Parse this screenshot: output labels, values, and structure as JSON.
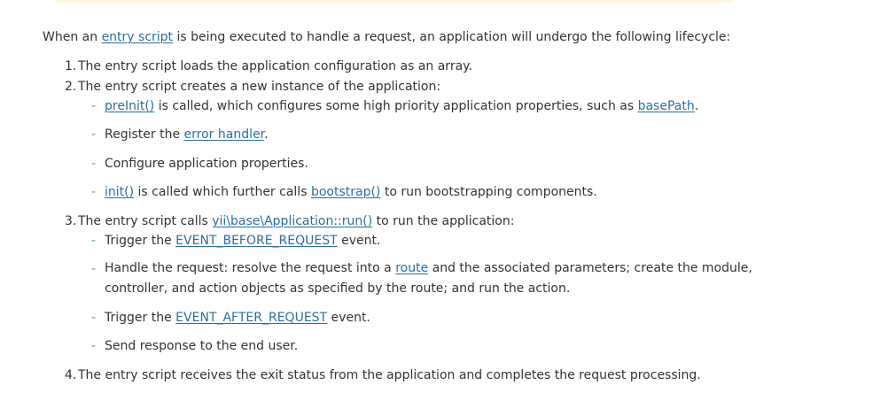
{
  "intro": {
    "before": "When an ",
    "link": "entry script",
    "after": " is being executed to handle a request, an application will undergo the following lifecycle:"
  },
  "steps": {
    "s1": {
      "num": "1.",
      "text": "The entry script loads the application configuration as an array."
    },
    "s2": {
      "num": "2.",
      "text": "The entry script creates a new instance of the application:",
      "b1": {
        "link1": "preInit()",
        "mid": " is called, which configures some high priority application properties, such as ",
        "link2": "basePath",
        "end": "."
      },
      "b2": {
        "before": "Register the ",
        "link": "error handler",
        "end": "."
      },
      "b3": {
        "text": "Configure application properties."
      },
      "b4": {
        "link1": "init()",
        "mid": " is called which further calls ",
        "link2": "bootstrap()",
        "end": " to run bootstrapping components."
      }
    },
    "s3": {
      "num": "3.",
      "before": "The entry script calls ",
      "link": "yii\\base\\Application::run()",
      "after": " to run the application:",
      "b1": {
        "before": "Trigger the ",
        "link": "EVENT_BEFORE_REQUEST",
        "end": " event."
      },
      "b2": {
        "before": "Handle the request: resolve the request into a ",
        "link": "route",
        "end": " and the associated parameters; create the module, controller, and action objects as specified by the route; and run the action."
      },
      "b3": {
        "before": "Trigger the ",
        "link": "EVENT_AFTER_REQUEST",
        "end": " event."
      },
      "b4": {
        "text": "Send response to the end user."
      }
    },
    "s4": {
      "num": "4.",
      "text": "The entry script receives the exit status from the application and completes the request processing."
    }
  },
  "colors": {
    "text": "#333333",
    "link": "#2b6f9d",
    "bullet": "#4aa3a9",
    "top_strip": "#fdf7dd"
  }
}
